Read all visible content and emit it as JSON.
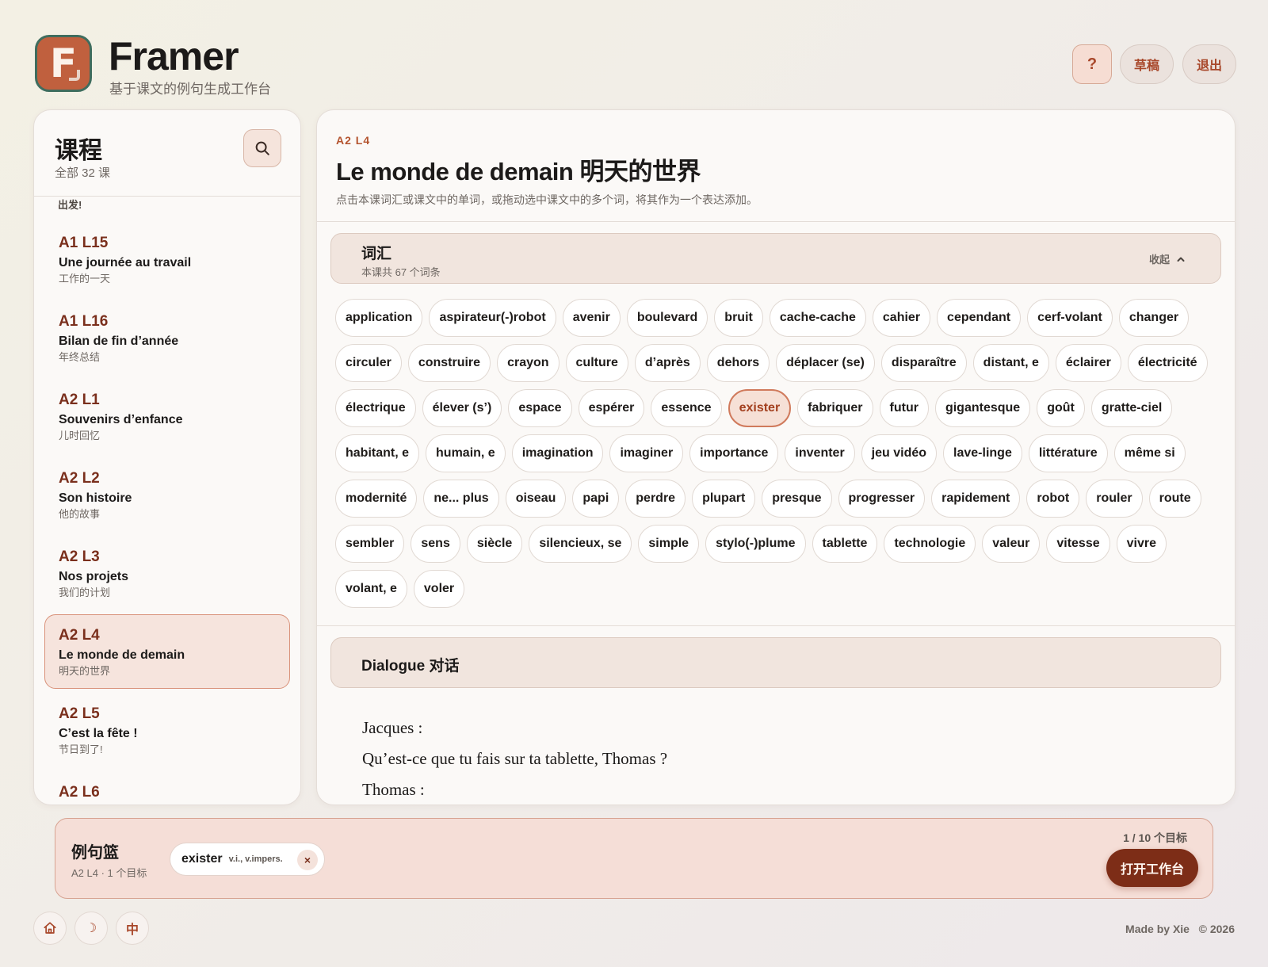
{
  "header": {
    "app_title": "Framer",
    "app_subtitle": "基于课文的例句生成工作台",
    "logo_letter": "F",
    "help_label": "?",
    "drafts_label": "草稿",
    "logout_label": "退出"
  },
  "sidebar": {
    "title": "课程",
    "count": "全部 32 课",
    "search_icon": "search-icon",
    "partial_top": "出发!",
    "lessons": [
      {
        "code": "A1 L15",
        "name": "Une journée au travail",
        "cn": "工作的一天",
        "active": false
      },
      {
        "code": "A1 L16",
        "name": "Bilan de fin d’année",
        "cn": "年终总结",
        "active": false
      },
      {
        "code": "A2 L1",
        "name": "Souvenirs d’enfance",
        "cn": "儿时回忆",
        "active": false
      },
      {
        "code": "A2 L2",
        "name": "Son histoire",
        "cn": "他的故事",
        "active": false
      },
      {
        "code": "A2 L3",
        "name": "Nos projets",
        "cn": "我们的计划",
        "active": false
      },
      {
        "code": "A2 L4",
        "name": "Le monde de demain",
        "cn": "明天的世界",
        "active": true
      },
      {
        "code": "A2 L5",
        "name": "C’est la fête !",
        "cn": "节日到了!",
        "active": false
      },
      {
        "code": "A2 L6",
        "name": "",
        "cn": "",
        "active": false
      }
    ]
  },
  "main": {
    "code": "A2 L4",
    "title": "Le monde de demain 明天的世界",
    "hint": "点击本课词汇或课文中的单词，或拖动选中课文中的多个词，将其作为一个表达添加。",
    "vocab": {
      "title": "词汇",
      "subtitle": "本课共 67 个词条",
      "collapse_label": "收起",
      "selected": "exister",
      "words": [
        "application",
        "aspirateur(-)robot",
        "avenir",
        "boulevard",
        "bruit",
        "cache-cache",
        "cahier",
        "cependant",
        "cerf-volant",
        "changer",
        "circuler",
        "construire",
        "crayon",
        "culture",
        "d’après",
        "dehors",
        "déplacer (se)",
        "disparaître",
        "distant, e",
        "éclairer",
        "électricité",
        "électrique",
        "élever (s’)",
        "espace",
        "espérer",
        "essence",
        "exister",
        "fabriquer",
        "futur",
        "gigantesque",
        "goût",
        "gratte-ciel",
        "habitant, e",
        "humain, e",
        "imagination",
        "imaginer",
        "importance",
        "inventer",
        "jeu vidéo",
        "lave-linge",
        "littérature",
        "même si",
        "modernité",
        "ne... plus",
        "oiseau",
        "papi",
        "perdre",
        "plupart",
        "presque",
        "progresser",
        "rapidement",
        "robot",
        "rouler",
        "route",
        "sembler",
        "sens",
        "siècle",
        "silencieux, se",
        "simple",
        "stylo(-)plume",
        "tablette",
        "technologie",
        "valeur",
        "vitesse",
        "vivre",
        "volant, e",
        "voler"
      ]
    },
    "dialogue": {
      "title": "Dialogue 对话",
      "lines": [
        "Jacques :",
        "Qu’est-ce que tu fais sur ta tablette, Thomas ?",
        "Thomas :"
      ]
    }
  },
  "basket": {
    "title": "例句篮",
    "subtitle": "A2 L4 · 1 个目标",
    "items": [
      {
        "word": "exister",
        "pos": "v.i., v.impers."
      }
    ],
    "remove_label": "×",
    "progress": "1 / 10 个目标",
    "open_label": "打开工作台"
  },
  "footer": {
    "home_icon": "home-icon",
    "theme_label": "☽",
    "lang_label": "中",
    "credit": "Made by Xie",
    "copyright": "© 2026"
  },
  "colors": {
    "accent": "#b4542f",
    "accent_dark": "#7d2d17",
    "section_bg": "#f1e5de",
    "basket_bg": "#f5ded7"
  }
}
